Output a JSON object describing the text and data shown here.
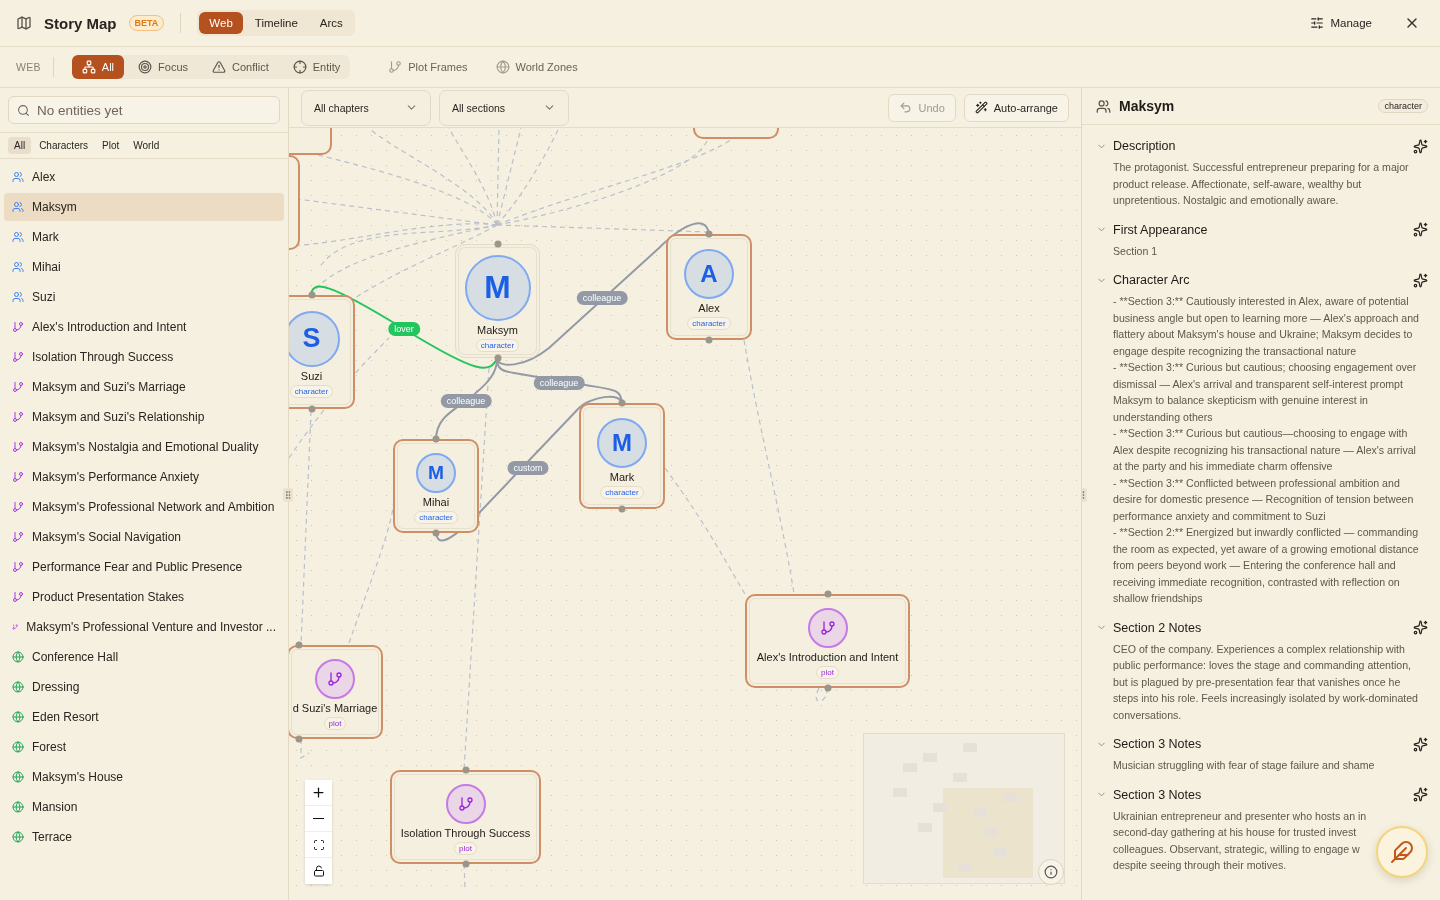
{
  "app": {
    "title": "Story Map",
    "badge": "BETA"
  },
  "views": [
    {
      "label": "Web",
      "selected": true
    },
    {
      "label": "Timeline",
      "selected": false
    },
    {
      "label": "Arcs",
      "selected": false
    }
  ],
  "header_actions": {
    "manage": "Manage"
  },
  "toolbar": {
    "label": "WEB",
    "modes": [
      {
        "label": "All",
        "selected": true
      },
      {
        "label": "Focus",
        "selected": false
      },
      {
        "label": "Conflict",
        "selected": false
      },
      {
        "label": "Entity",
        "selected": false
      }
    ],
    "overlays": [
      {
        "label": "Plot Frames",
        "on": false
      },
      {
        "label": "World Zones",
        "on": false
      }
    ]
  },
  "sidebar": {
    "search": {
      "placeholder": "No entities yet"
    },
    "filters": [
      {
        "label": "All",
        "selected": true
      },
      {
        "label": "Characters",
        "selected": false
      },
      {
        "label": "Plot",
        "selected": false
      },
      {
        "label": "World",
        "selected": false
      }
    ],
    "items": [
      {
        "kind": "character",
        "label": "Alex",
        "selected": false
      },
      {
        "kind": "character",
        "label": "Maksym",
        "selected": true
      },
      {
        "kind": "character",
        "label": "Mark",
        "selected": false
      },
      {
        "kind": "character",
        "label": "Mihai",
        "selected": false
      },
      {
        "kind": "character",
        "label": "Suzi",
        "selected": false
      },
      {
        "kind": "plot",
        "label": "Alex's Introduction and Intent",
        "selected": false
      },
      {
        "kind": "plot",
        "label": "Isolation Through Success",
        "selected": false
      },
      {
        "kind": "plot",
        "label": "Maksym and Suzi's Marriage",
        "selected": false
      },
      {
        "kind": "plot",
        "label": "Maksym and Suzi's Relationship",
        "selected": false
      },
      {
        "kind": "plot",
        "label": "Maksym's Nostalgia and Emotional Duality",
        "selected": false
      },
      {
        "kind": "plot",
        "label": "Maksym's Performance Anxiety",
        "selected": false
      },
      {
        "kind": "plot",
        "label": "Maksym's Professional Network and Ambition",
        "selected": false
      },
      {
        "kind": "plot",
        "label": "Maksym's Social Navigation",
        "selected": false
      },
      {
        "kind": "plot",
        "label": "Performance Fear and Public Presence",
        "selected": false
      },
      {
        "kind": "plot",
        "label": "Product Presentation Stakes",
        "selected": false
      },
      {
        "kind": "plot",
        "label": "Maksym's Professional Venture and Investor ...",
        "selected": false
      },
      {
        "kind": "world",
        "label": "Conference Hall",
        "selected": false
      },
      {
        "kind": "world",
        "label": "Dressing",
        "selected": false
      },
      {
        "kind": "world",
        "label": "Eden Resort",
        "selected": false
      },
      {
        "kind": "world",
        "label": "Forest",
        "selected": false
      },
      {
        "kind": "world",
        "label": "Maksym's House",
        "selected": false
      },
      {
        "kind": "world",
        "label": "Mansion",
        "selected": false
      },
      {
        "kind": "world",
        "label": "Terrace",
        "selected": false
      }
    ]
  },
  "canvas": {
    "chapter_filter": "All chapters",
    "section_filter": "All sections",
    "undo": {
      "label": "Undo",
      "disabled": true
    },
    "auto_arrange": "Auto-arrange",
    "nodes": [
      {
        "kind": "character",
        "initial": "M",
        "name": "Maksym",
        "tag": "character",
        "selected": true
      },
      {
        "kind": "character",
        "initial": "A",
        "name": "Alex",
        "tag": "character",
        "selected": false
      },
      {
        "kind": "character",
        "initial": "S",
        "name": "Suzi",
        "tag": "character",
        "selected": false
      },
      {
        "kind": "character",
        "initial": "M",
        "name": "Mihai",
        "tag": "character",
        "selected": false
      },
      {
        "kind": "character",
        "initial": "M",
        "name": "Mark",
        "tag": "character",
        "selected": false
      },
      {
        "kind": "plot",
        "name": "Alex's Introduction and Intent",
        "tag": "plot",
        "selected": false
      },
      {
        "kind": "plot",
        "name": "d Suzi's Marriage",
        "tag": "plot",
        "selected": false
      },
      {
        "kind": "plot",
        "name": "Isolation Through Success",
        "tag": "plot",
        "selected": false
      }
    ],
    "edges": [
      {
        "label": "lover",
        "color": "#22c55e"
      },
      {
        "label": "colleague",
        "color": "#939aa6"
      },
      {
        "label": "colleague",
        "color": "#939aa6"
      },
      {
        "label": "colleague",
        "color": "#939aa6"
      },
      {
        "label": "custom",
        "color": "#939aa6"
      }
    ]
  },
  "detail": {
    "name": "Maksym",
    "tag": "character",
    "sections": [
      {
        "title": "Description",
        "expanded": true,
        "paragraphs": [
          "The protagonist. Successful entrepreneur preparing for a major product release. Affectionate, self-aware, wealthy but unpretentious. Nostalgic and emotionally aware."
        ]
      },
      {
        "title": "First Appearance",
        "expanded": true,
        "paragraphs": [
          "Section 1"
        ]
      },
      {
        "title": "Character Arc",
        "expanded": true,
        "paragraphs": [
          "- **Section 3:** Cautiously interested in Alex, aware of potential business angle but open to learning more — Alex's approach and flattery about Maksym's house and Ukraine; Maksym decides to engage despite recognizing the transactional nature",
          "- **Section 3:** Curious but cautious; choosing engagement over dismissal — Alex's arrival and transparent self-interest prompt Maksym to balance skepticism with genuine interest in understanding others",
          "- **Section 3:** Curious but cautious—choosing to engage with Alex despite recognizing his transactional nature — Alex's arrival at the party and his immediate charm offensive",
          "- **Section 3:** Conflicted between professional ambition and desire for domestic presence — Recognition of tension between performance anxiety and commitment to Suzi",
          "- **Section 2:** Energized but inwardly conflicted — commanding the room as expected, yet aware of a growing emotional distance from peers beyond work — Entering the conference hall and receiving immediate recognition, contrasted with reflection on shallow friendships"
        ]
      },
      {
        "title": "Section 2 Notes",
        "expanded": true,
        "paragraphs": [
          "CEO of the company. Experiences a complex relationship with public performance: loves the stage and commanding attention, but is plagued by pre-presentation fear that vanishes once he steps into his role. Feels increasingly isolated by work-dominated conversations."
        ]
      },
      {
        "title": "Section 3 Notes",
        "expanded": true,
        "paragraphs": [
          "Musician struggling with fear of stage failure and shame"
        ]
      },
      {
        "title": "Section 3 Notes",
        "expanded": true,
        "paragraphs": [
          "Ukrainian entrepreneur and presenter who hosts an in",
          "second-day gathering at his house for trusted invest",
          "colleagues. Observant, strategic, willing to engage w",
          "despite seeing through their motives."
        ]
      }
    ]
  }
}
